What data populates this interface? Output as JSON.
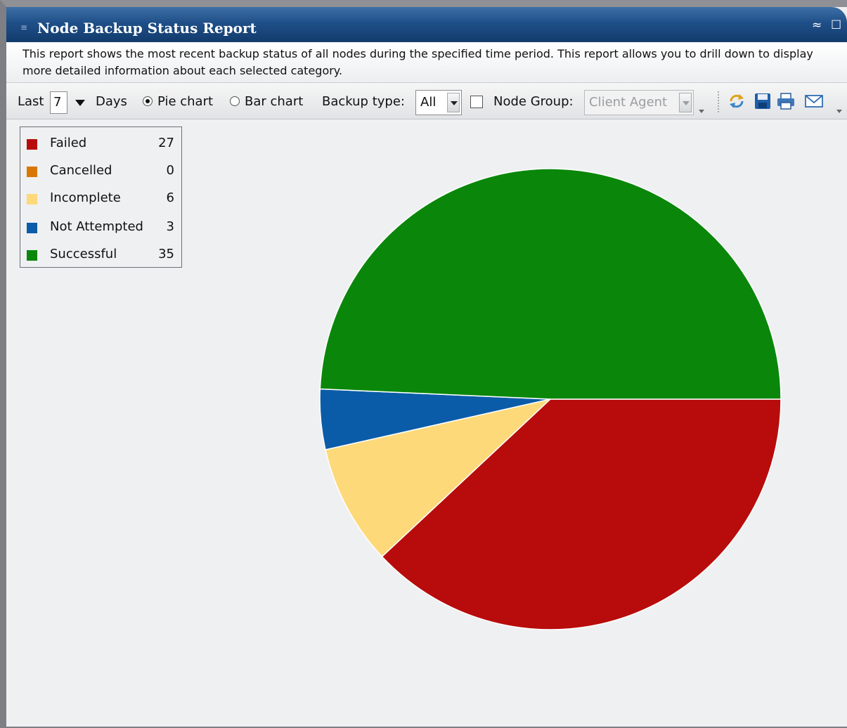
{
  "window": {
    "title": "Node Backup Status Report",
    "description": "This report shows the most recent backup status of all nodes during the specified time period. This report allows you to drill down to display more detailed information about each selected category."
  },
  "toolbar": {
    "last_label": "Last",
    "days_value": "7",
    "days_label": "Days",
    "pie_label": "Pie chart",
    "bar_label": "Bar chart",
    "selected_chart": "pie",
    "backup_type_label": "Backup type:",
    "backup_type_value": "All",
    "node_group_checked": false,
    "node_group_label": "Node Group:",
    "node_group_value": "Client Agent",
    "icons": [
      "refresh-icon",
      "save-icon",
      "print-icon",
      "email-icon"
    ]
  },
  "chart_data": {
    "type": "pie",
    "categories": [
      "Failed",
      "Cancelled",
      "Incomplete",
      "Not Attempted",
      "Successful"
    ],
    "values": [
      27,
      0,
      6,
      3,
      35
    ],
    "colors": [
      "#b80c0c",
      "#d97706",
      "#fdd97a",
      "#0b5ca8",
      "#0a870a"
    ],
    "legend_position": "top-left"
  }
}
